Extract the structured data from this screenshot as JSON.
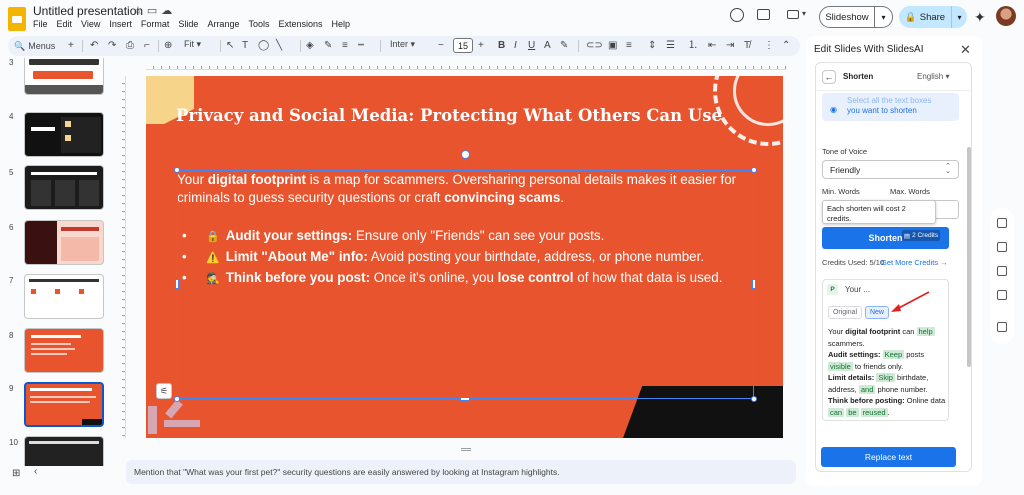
{
  "app": {
    "title": "Untitled presentation",
    "menus": [
      "File",
      "Edit",
      "View",
      "Insert",
      "Format",
      "Slide",
      "Arrange",
      "Tools",
      "Extensions",
      "Help"
    ]
  },
  "header": {
    "slideshow_label": "Slideshow",
    "share_label": "Share"
  },
  "toolbar": {
    "search_label": "Menus",
    "zoom_label": "Fit",
    "font_label": "Inter",
    "font_size": "15"
  },
  "filmstrip": {
    "slide_numbers": [
      "3",
      "4",
      "5",
      "6",
      "7",
      "8",
      "9",
      "10"
    ],
    "selected": "9"
  },
  "slide": {
    "title": "Privacy and Social Media: Protecting What Others Can Use",
    "body_pre": "Your ",
    "body_b1": "digital footprint",
    "body_mid": " is a map for scammers. Oversharing personal details makes it easier for criminals to guess security questions or craft ",
    "body_b2": "convincing scams",
    "body_post": ".",
    "bullets": [
      {
        "emoji": "🔒",
        "bold": "Audit your settings:",
        "text": " Ensure only \"Friends\" can see your posts."
      },
      {
        "emoji": "⚠️",
        "bold": "Limit \"About Me\" info:",
        "text": " Avoid posting your birthdate, address, or phone number."
      },
      {
        "emoji": "🕵️",
        "bold": "Think before you post:",
        "text": " Once it's online, you ",
        "bold2": "lose control",
        "text2": " of how that data is used."
      }
    ]
  },
  "notes": {
    "text": "Mention that \"What was your first pet?\" security questions are easily answered by looking at Instagram highlights."
  },
  "panel": {
    "title": "Edit Slides With SlidesAI",
    "mode": "Shorten",
    "language": "English",
    "tip_line1": "Select all the text boxes",
    "tip_line2": "you want to shorten",
    "tone_label": "Tone of Voice",
    "tone_value": "Friendly",
    "min_words_label": "Min. Words",
    "max_words_label": "Max. Words",
    "tooltip_text": "Each shorten will cost 2 credits.",
    "shorten_label": "Shorten",
    "credits_badge": "2 Credits",
    "credits_used": "Credits Used: 5/10",
    "get_more": "Get More Credits →",
    "prompt_badge": "P",
    "prompt_text": "Your ...",
    "tab_original": "Original",
    "tab_new": "New",
    "replace_label": "Replace text"
  },
  "colors": {
    "slide_bg": "#e8542e",
    "accent_blue": "#1a73e8",
    "highlight_green": "#ceead6"
  },
  "icons": [
    "star-icon",
    "move-icon",
    "cloud-icon",
    "history-icon",
    "comment-icon",
    "camera-icon",
    "lock-icon",
    "gemini-icon",
    "close-icon",
    "back-arrow-icon",
    "grid-icon"
  ]
}
